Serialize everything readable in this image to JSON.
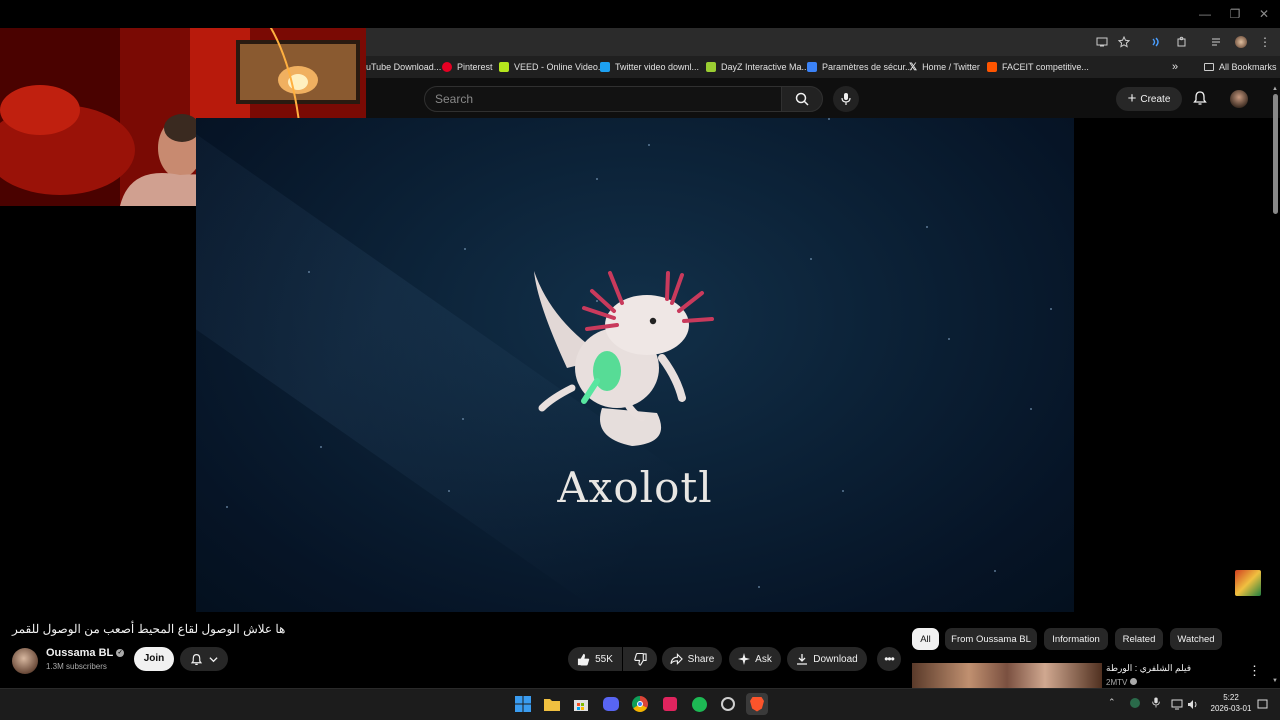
{
  "bookmarks": [
    {
      "label": "uTube Download...",
      "color": "#cc0000"
    },
    {
      "label": "Pinterest",
      "color": "#e60023"
    },
    {
      "label": "VEED - Online Video...",
      "color": "#b5e61d"
    },
    {
      "label": "Twitter video downl...",
      "color": "#1da1f2"
    },
    {
      "label": "DayZ Interactive Ma...",
      "color": "#9acd32"
    },
    {
      "label": "Paramètres de sécur...",
      "color": "#3b82f6"
    },
    {
      "label": "Home / Twitter",
      "color": "#ffffff"
    },
    {
      "label": "FACEIT competitive...",
      "color": "#ff5500"
    }
  ],
  "bookmarks_all": "All Bookmarks",
  "header": {
    "search_placeholder": "Search",
    "create_label": "Create"
  },
  "video": {
    "overlay_title": "Axolotl"
  },
  "info": {
    "title": "ها علاش الوصول لقاع المحيط أصعب من الوصول للقمر",
    "channel_name": "Oussama BL",
    "subscribers": "1.3M subscribers",
    "join_label": "Join",
    "like_count": "55K",
    "share_label": "Share",
    "ask_label": "Ask",
    "download_label": "Download"
  },
  "chips": [
    "All",
    "From Oussama BL",
    "Information",
    "Related",
    "Watched"
  ],
  "suggested": {
    "title": "فيلم الشلفري : الورطة",
    "channel": "2MTV"
  },
  "taskbar": {
    "time": "5:22",
    "date": "2026-03-01"
  }
}
